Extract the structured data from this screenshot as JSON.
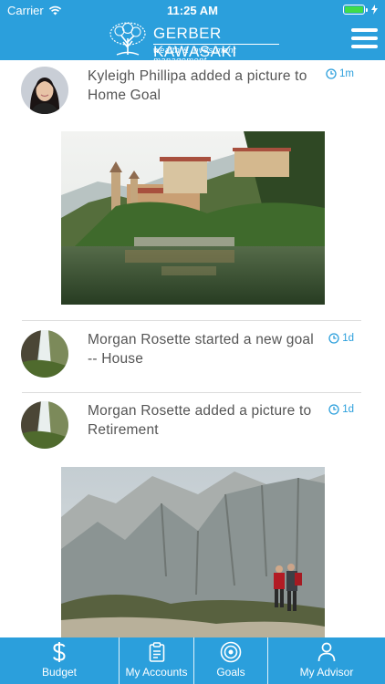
{
  "status_bar": {
    "carrier": "Carrier",
    "time": "11:25 AM",
    "battery_fill_fraction": 1.0
  },
  "header": {
    "brand_name": "GERBER KAWASAKI",
    "brand_tagline": "wealth & investment management",
    "accent_color": "#2b9fdc",
    "menu_icon": "hamburger-menu-icon"
  },
  "feed": [
    {
      "text_line1": "Kyleigh Phillipa added a picture to",
      "text_line2": "Home Goal",
      "time": "1m",
      "avatar": "woman-portrait",
      "photo": "lakeside-villa"
    },
    {
      "text_line1": "Morgan Rosette started a new goal",
      "text_line2": "-- House",
      "time": "1d",
      "avatar": "waterfall-landscape"
    },
    {
      "text_line1": "Morgan Rosette added a picture to",
      "text_line2": "Retirement",
      "time": "1d",
      "avatar": "waterfall-landscape",
      "photo": "mountain-hikers"
    }
  ],
  "tabs": [
    {
      "label": "Budget",
      "icon": "dollar-icon"
    },
    {
      "label": "My Accounts",
      "icon": "clipboard-icon"
    },
    {
      "label": "Goals",
      "icon": "target-icon"
    },
    {
      "label": "My Advisor",
      "icon": "person-icon"
    }
  ]
}
